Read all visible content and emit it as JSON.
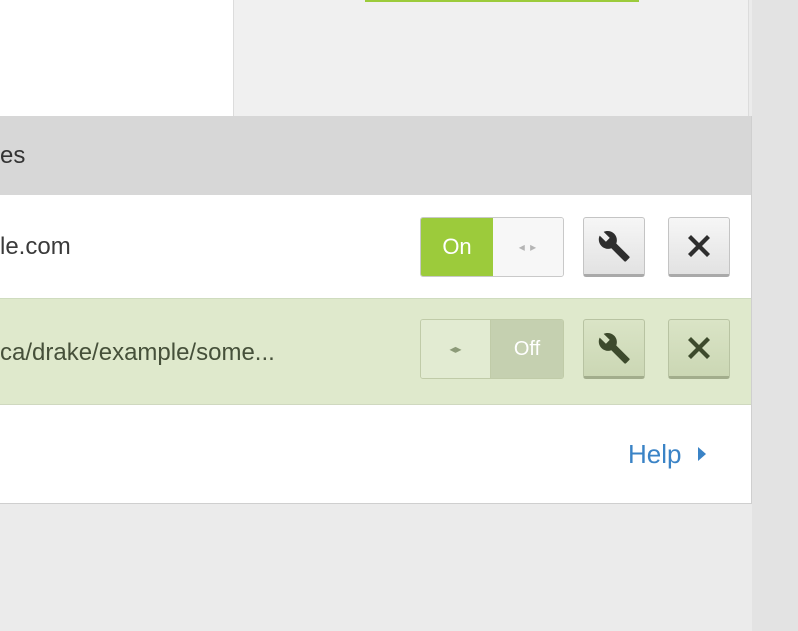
{
  "section": {
    "header_title": "es"
  },
  "rows": [
    {
      "url": "le.com",
      "toggle_state": "on",
      "toggle_label": "On",
      "toggle_handle_glyph": "◂ ▸"
    },
    {
      "url": "ca/drake/example/some...",
      "toggle_state": "off",
      "toggle_label": "Off",
      "toggle_handle_glyph": "◂▸"
    }
  ],
  "footer": {
    "help_label": "Help"
  },
  "colors": {
    "accent_green": "#9ccb3b",
    "row_highlight": "#dfe9cc",
    "link_blue": "#3a83c6"
  },
  "icons": {
    "configure": "wrench-icon",
    "remove": "close-icon",
    "help_arrow": "chevron-right-icon"
  }
}
